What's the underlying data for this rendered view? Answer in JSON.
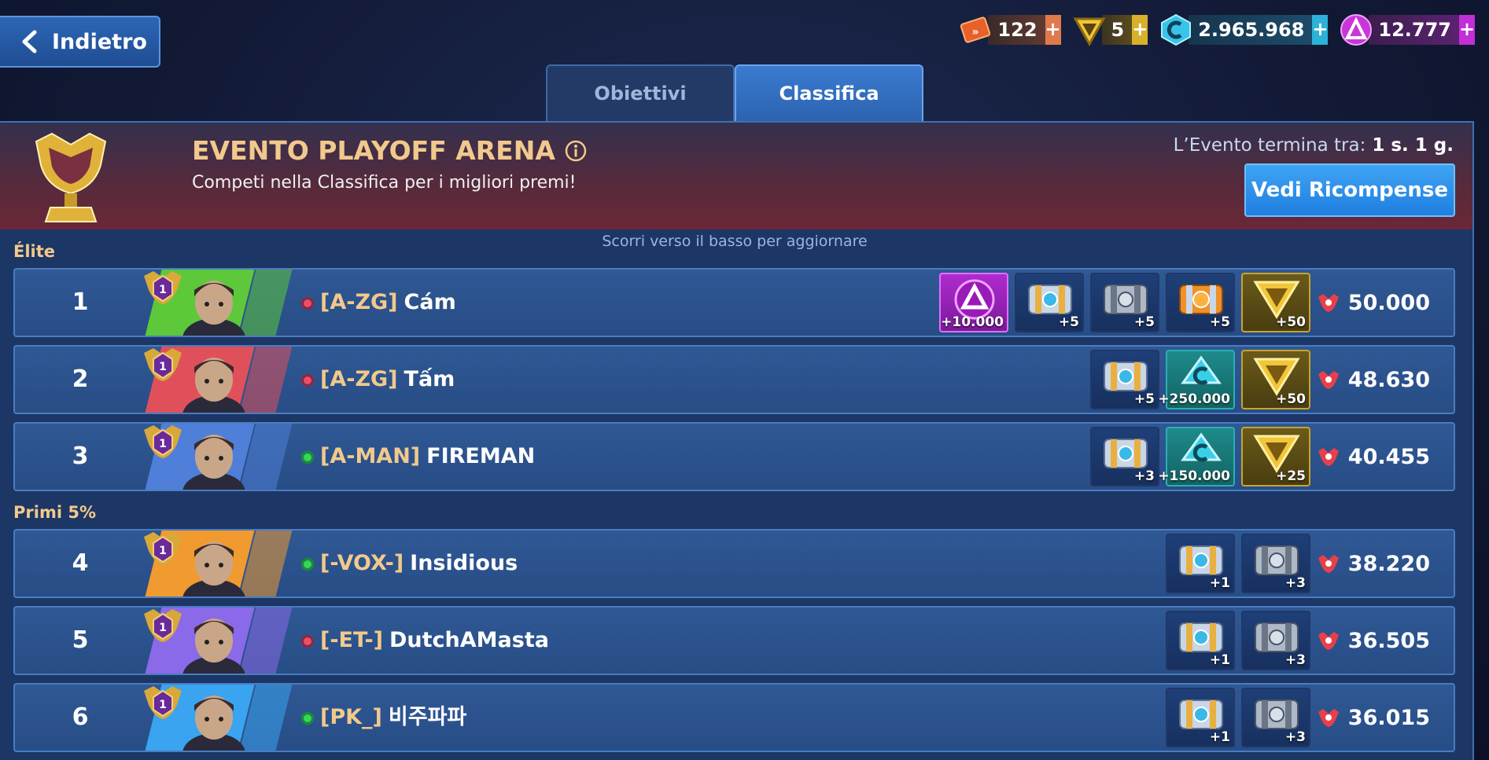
{
  "header": {
    "back_label": "Indietro"
  },
  "currencies": [
    {
      "name": "tickets",
      "value": "122"
    },
    {
      "name": "tokens",
      "value": "5"
    },
    {
      "name": "credits",
      "value": "2.965.968"
    },
    {
      "name": "points",
      "value": "12.777"
    }
  ],
  "plus_label": "+",
  "tabs": [
    {
      "label": "Obiettivi",
      "active": false
    },
    {
      "label": "Classifica",
      "active": true
    }
  ],
  "event": {
    "title": "EVENTO PLAYOFF ARENA",
    "subtitle": "Competi nella Classifica per i migliori premi!",
    "ends_label": "L’Evento termina tra:",
    "ends_value": "1 s. 1 g.",
    "rewards_button": "Vedi Ricompense"
  },
  "hint": "Scorri verso il basso per aggiornare",
  "sections": {
    "elite": "Élite",
    "top5": "Primi 5%"
  },
  "badge_level": "1",
  "rows": [
    {
      "rank": "1",
      "tag": "[A-ZG]",
      "name": "Cám",
      "status": "red",
      "score": "50.000",
      "color": "#5cc83a",
      "rewards": [
        {
          "type": "pts",
          "amt": "+10.000"
        },
        {
          "type": "crate",
          "amt": "+5"
        },
        {
          "type": "silver",
          "amt": "+5"
        },
        {
          "type": "gold",
          "amt": "+5"
        },
        {
          "type": "tok",
          "amt": "+50"
        }
      ]
    },
    {
      "rank": "2",
      "tag": "[A-ZG]",
      "name": "Tấm",
      "status": "red",
      "score": "48.630",
      "color": "#e0505a",
      "rewards": [
        {
          "type": "crate",
          "amt": "+5"
        },
        {
          "type": "cred",
          "amt": "+250.000"
        },
        {
          "type": "tok",
          "amt": "+50"
        }
      ]
    },
    {
      "rank": "3",
      "tag": "[A-MAN]",
      "name": "FIREMAN",
      "status": "green",
      "score": "40.455",
      "color": "#4f7fd8",
      "rewards": [
        {
          "type": "crate",
          "amt": "+3"
        },
        {
          "type": "cred",
          "amt": "+150.000"
        },
        {
          "type": "tok",
          "amt": "+25"
        }
      ]
    },
    {
      "rank": "4",
      "tag": "[-VOX-]",
      "name": "Insidious",
      "status": "green",
      "score": "38.220",
      "color": "#f09a30",
      "rewards": [
        {
          "type": "crate",
          "amt": "+1"
        },
        {
          "type": "silver",
          "amt": "+3"
        }
      ]
    },
    {
      "rank": "5",
      "tag": "[-ET-]",
      "name": "DutchAMasta",
      "status": "red",
      "score": "36.505",
      "color": "#8a6ae8",
      "rewards": [
        {
          "type": "crate",
          "amt": "+1"
        },
        {
          "type": "silver",
          "amt": "+3"
        }
      ]
    },
    {
      "rank": "6",
      "tag": "[PK_]",
      "name": "비주파파",
      "status": "green",
      "score": "36.015",
      "color": "#3aa4f0",
      "rewards": [
        {
          "type": "crate",
          "amt": "+1"
        },
        {
          "type": "silver",
          "amt": "+3"
        }
      ]
    }
  ]
}
